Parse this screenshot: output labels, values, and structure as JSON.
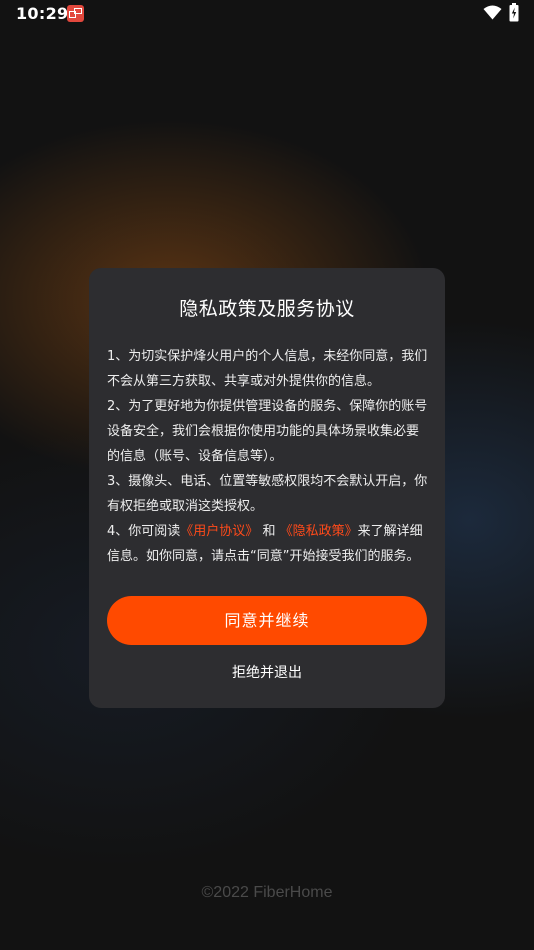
{
  "status_bar": {
    "time": "10:29",
    "notification_icon": "app-notification-icon",
    "wifi_icon": "wifi-icon",
    "battery_icon": "battery-charging-icon"
  },
  "dialog": {
    "title": "隐私政策及服务协议",
    "paragraphs": {
      "p1": "1、为切实保护烽火用户的个人信息，未经你同意，我们不会从第三方获取、共享或对外提供你的信息。",
      "p2": "2、为了更好地为你提供管理设备的服务、保障你的账号设备安全，我们会根据你使用功能的具体场景收集必要的信息（账号、设备信息等）。",
      "p3": "3、摄像头、电话、位置等敏感权限均不会默认开启，你有权拒绝或取消这类授权。",
      "p4": {
        "prefix": "4、你可阅读",
        "link_user_agreement": "《用户协议》",
        "connector": "和",
        "link_privacy_policy": "《隐私政策》",
        "suffix": "来了解详细信息。如你同意，请点击“同意”开始接受我们的服务。"
      }
    },
    "agree_button": "同意并继续",
    "reject_button": "拒绝并退出"
  },
  "footer": {
    "copyright": "©2022 FiberHome"
  },
  "colors": {
    "accent": "#ff4a00",
    "link": "#ff4a1a",
    "dialog_bg": "#2d2d30",
    "page_bg": "#121212"
  }
}
